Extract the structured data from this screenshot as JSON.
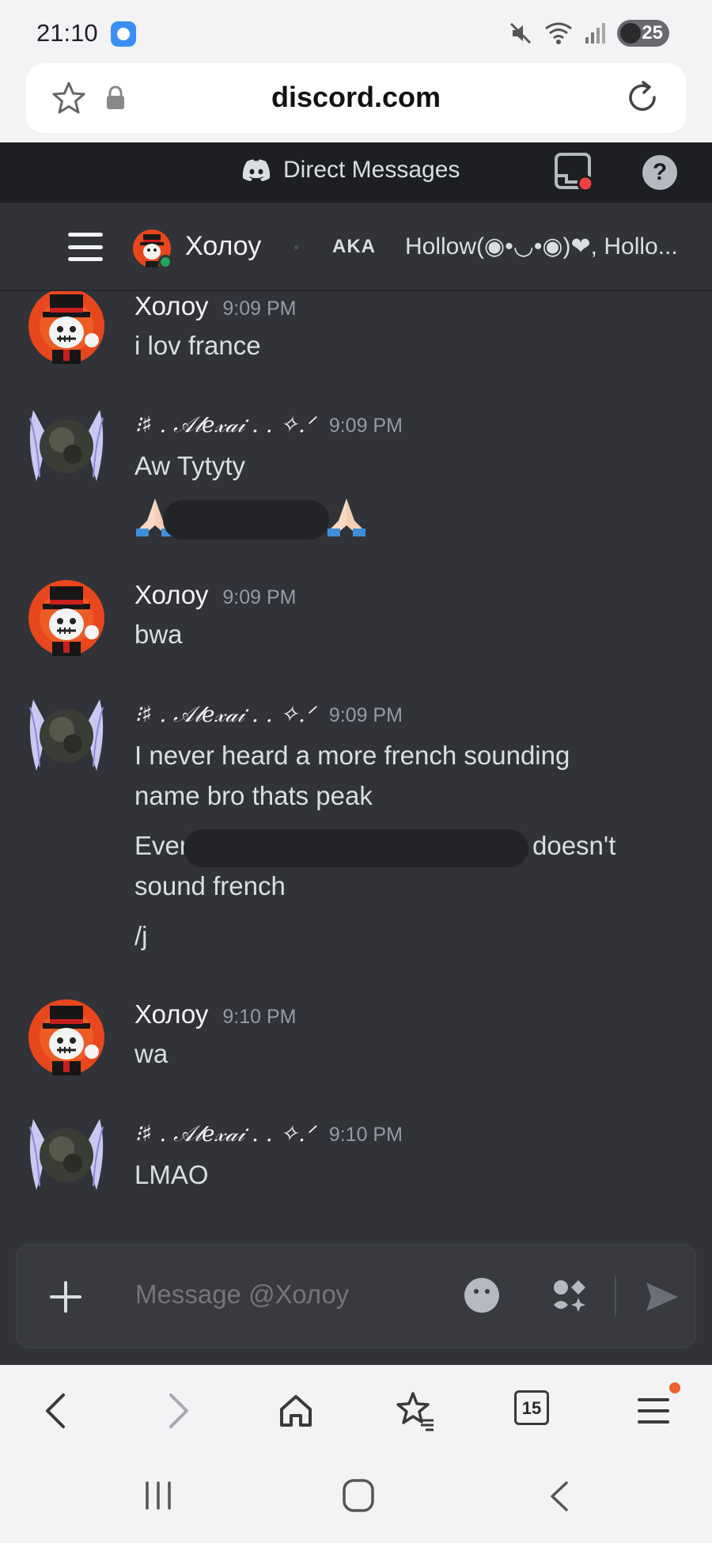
{
  "status_bar": {
    "time": "21:10",
    "battery": "25"
  },
  "browser": {
    "url": "discord.com",
    "tab_count": "15"
  },
  "discord_header": {
    "title": "Direct Messages",
    "help_label": "?"
  },
  "channel": {
    "name": "Холоу",
    "aka_badge": "AKA",
    "aka_names": "Hollow(◉•◡•◉)❤, Hollo..."
  },
  "messages": [
    {
      "author": "Холоу",
      "time": "9:09 PM",
      "lines": [
        "i lov france"
      ]
    },
    {
      "author": "⁝♯ . 𝒜𝓁𝑒𝓍𝒶𝒾 . . ✧.ᐟ",
      "time": "9:09 PM",
      "lines": [
        "Aw Tytyty"
      ]
    },
    {
      "author": "Холоу",
      "time": "9:09 PM",
      "lines": [
        "bwa"
      ]
    },
    {
      "author": "⁝♯ . 𝒜𝓁𝑒𝓍𝒶𝒾 . . ✧.ᐟ",
      "time": "9:09 PM",
      "lines": [
        "I never heard a more french sounding",
        "name bro thats peak",
        "Even",
        "doesn't",
        "sound french",
        "/j"
      ]
    },
    {
      "author": "Холоу",
      "time": "9:10 PM",
      "lines": [
        "wa"
      ]
    },
    {
      "author": "⁝♯ . 𝒜𝓁𝑒𝓍𝒶𝒾 . . ✧.ᐟ",
      "time": "9:10 PM",
      "lines": [
        "LMAO"
      ]
    }
  ],
  "composer": {
    "placeholder": "Message @Холоу"
  },
  "colors": {
    "discord_bg": "#313338",
    "header_bg": "#1e1f22",
    "online": "#23a55a",
    "notify_red": "#f23f43",
    "browser_dot": "#e8622a"
  }
}
